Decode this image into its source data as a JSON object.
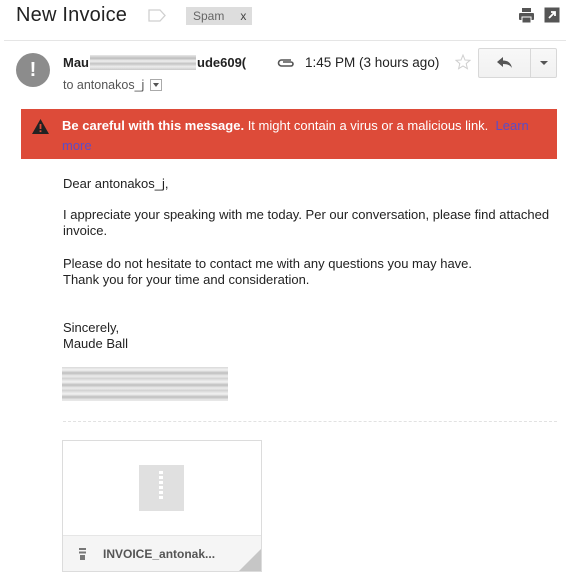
{
  "header": {
    "subject": "New Invoice",
    "label_icon": "label-tag-icon",
    "spam_label": "Spam",
    "spam_remove": "x",
    "icons": [
      "print-icon",
      "new-window-icon"
    ]
  },
  "message": {
    "avatar_glyph": "!",
    "sender_prefix": "Mau",
    "sender_suffix": "ude609(",
    "recipient_label": "to antonakos_j",
    "time": "1:45 PM (3 hours ago)",
    "icons": [
      "attachment-clip-icon",
      "star-icon",
      "reply-icon",
      "more-caret-icon"
    ]
  },
  "warning": {
    "bold": "Be careful with this message.",
    "text": " It might contain a virus or a malicious link.",
    "link": "Learn more",
    "color": "#dd4b39",
    "icon": "warning-triangle-icon"
  },
  "body": {
    "greeting": "Dear antonakos_j,",
    "para1": "I appreciate your speaking with me today. Per our conversation, please find attached invoice.",
    "para2_line1": "Please do not hesitate to contact me with any questions you may have.",
    "para2_line2": "Thank you for your time and consideration.",
    "closing_line1": "Sincerely,",
    "closing_line2": "Maude Ball"
  },
  "attachment": {
    "name": "INVOICE_antonak...",
    "icon": "zip-file-icon"
  }
}
